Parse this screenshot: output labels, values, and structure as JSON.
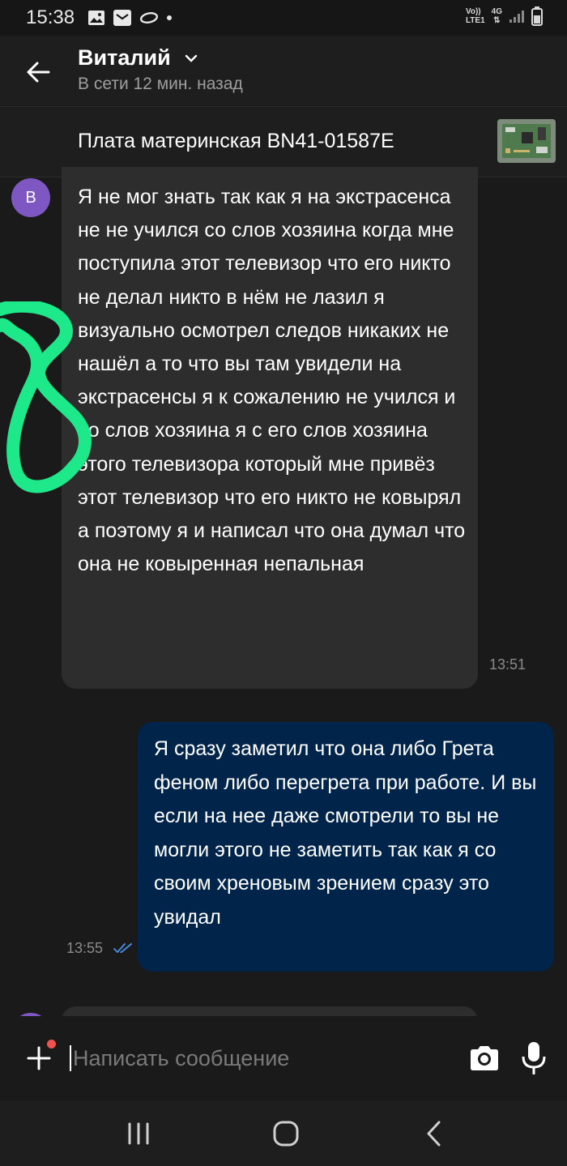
{
  "status_bar": {
    "time": "15:38",
    "network_top": "Vo))",
    "network_bottom": "LTE1",
    "data_type": "4G",
    "icons": [
      "image-icon",
      "email-icon",
      "avito-icon",
      "dot-icon",
      "signal-icon",
      "battery-icon"
    ]
  },
  "header": {
    "contact_name": "Виталий",
    "contact_status": "В сети 12 мин. назад",
    "icons": [
      "back-arrow-icon",
      "chevron-down-icon"
    ]
  },
  "product": {
    "title": "Плата материнская BN41-01587E"
  },
  "messages": [
    {
      "direction": "incoming",
      "avatar_letter": "В",
      "text": "Я не мог знать так как я на экстрасенса не не учился со слов хозяина когда мне поступила этот телевизор что его никто не делал никто в нём не лазил я визуально осмотрел следов никаких не нашёл а то что вы там увидели на экстрасенсы я к сожалению не учился и со слов хозяина я с его слов хозяина этого телевизора который мне привёз этот телевизор что его никто не ковырял а поэтому я и написал что она думал что она не ковыренная непальная",
      "time": "13:51"
    },
    {
      "direction": "outgoing",
      "text": "Я сразу заметил что она либо Грета феном либо перегрета при работе.  И вы если на нее даже смотрели то вы не могли этого не заметить так как я со своим хреновым зрением сразу это увидал",
      "time": "13:55",
      "status": "read"
    }
  ],
  "composer": {
    "placeholder": "Написать сообщение",
    "value": "",
    "icons": [
      "plus-icon",
      "camera-icon",
      "microphone-icon"
    ]
  },
  "nav_bar": {
    "icons": [
      "recent-apps-icon",
      "home-icon",
      "back-icon"
    ]
  },
  "overlay": {
    "annotation": "8",
    "color": "#1de98b"
  },
  "colors": {
    "background": "#1a1a1a",
    "incoming_bubble": "#2d2d2d",
    "outgoing_bubble": "#00244a",
    "avatar": "#7e57c2",
    "read_ticks": "#4a90e2",
    "notification_dot": "#ef5350"
  }
}
